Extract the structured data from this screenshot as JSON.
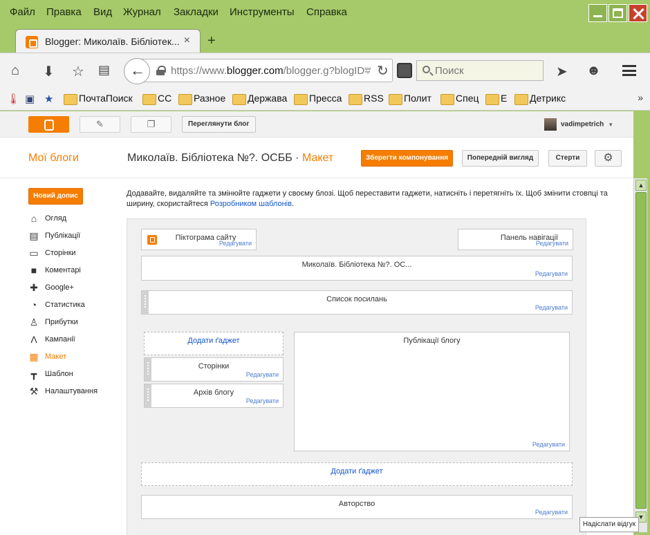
{
  "menu": [
    "Файл",
    "Правка",
    "Вид",
    "Журнал",
    "Закладки",
    "Инструменты",
    "Справка"
  ],
  "tab": {
    "title": "Blogger: Миколаїв. Бібліотек...",
    "close": "×",
    "new": "+"
  },
  "url": {
    "prefix": "https://www.",
    "host": "blogger.com",
    "path": "/blogger.g?blogID="
  },
  "search": {
    "placeholder": "Поиск"
  },
  "bookmarks": [
    "ПочтаПоиск",
    "СС",
    "Разное",
    "Держава",
    "Пресса",
    "RSS",
    "Полит",
    "Спец",
    "Е",
    "Детрикс"
  ],
  "bookmarks_more": "»",
  "topbar": {
    "view_blog": "Переглянути блог",
    "user": "vadimpetrich"
  },
  "header": {
    "my_blogs": "Мої блоги",
    "blog_title": "Миколаїв. Бібліотека №?. ОСББ",
    "sep": "·",
    "section": "Макет",
    "save": "Зберегти компонування",
    "preview": "Попередній вигляд",
    "clear": "Стерти"
  },
  "new_post": "Новий допис",
  "nav": [
    {
      "label": "Огляд",
      "icon": "home-icon",
      "glyph": "⌂"
    },
    {
      "label": "Публікації",
      "icon": "posts-icon",
      "glyph": "▤"
    },
    {
      "label": "Сторінки",
      "icon": "pages-icon",
      "glyph": "▭"
    },
    {
      "label": "Коментарі",
      "icon": "comments-icon",
      "glyph": "■"
    },
    {
      "label": "Google+",
      "icon": "google-plus-icon",
      "glyph": "✚"
    },
    {
      "label": "Статистика",
      "icon": "stats-icon",
      "glyph": "◔"
    },
    {
      "label": "Прибутки",
      "icon": "earnings-icon",
      "glyph": "♙"
    },
    {
      "label": "Кампанії",
      "icon": "campaigns-icon",
      "glyph": "Λ"
    },
    {
      "label": "Макет",
      "icon": "layout-icon",
      "glyph": "▦",
      "active": true
    },
    {
      "label": "Шаблон",
      "icon": "template-icon",
      "glyph": "┳"
    },
    {
      "label": "Налаштування",
      "icon": "settings-icon",
      "glyph": "⚒"
    }
  ],
  "intro": {
    "text": "Додавайте, видаляйте та змінюйте гаджети у своєму блозі. Щоб переставити гаджети, натисніть і перетягніть їх. Щоб змінити стовпці та ширину, скористайтеся ",
    "link": "Розробником шаблонів",
    "end": "."
  },
  "gadgets": {
    "edit": "Редагувати",
    "favicon": "Піктограма сайту",
    "navbar": "Панель навігації",
    "header": "Миколаїв. Бібліотека №?. ОС...",
    "linklist": "Список посилань",
    "add": "Додати ґаджет",
    "pages": "Сторінки",
    "archive": "Архів блогу",
    "posts": "Публікації блогу",
    "attribution": "Авторство"
  },
  "feedback": "Надіслати відгук"
}
